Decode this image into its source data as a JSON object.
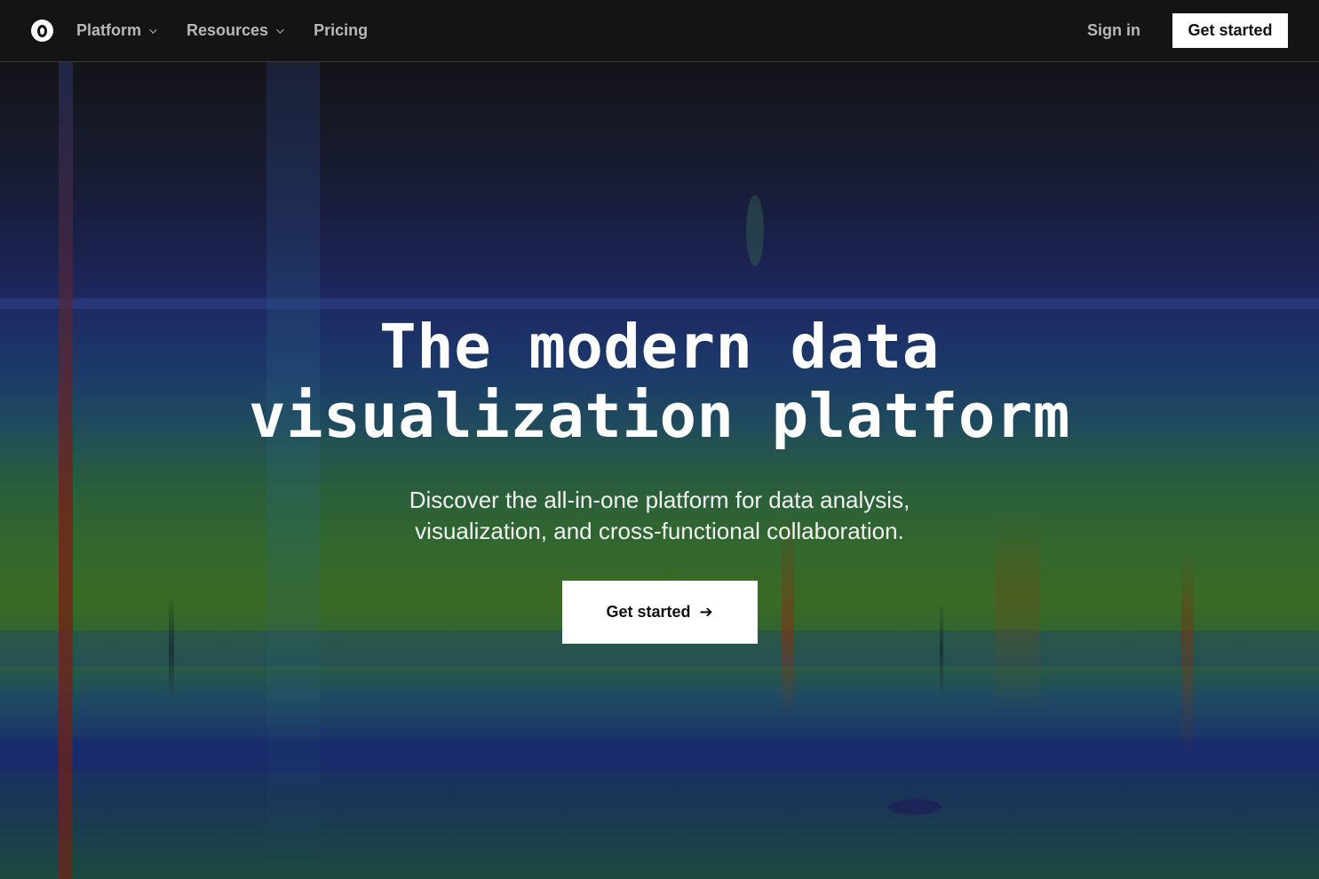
{
  "nav": {
    "items": [
      {
        "label": "Platform",
        "has_dropdown": true
      },
      {
        "label": "Resources",
        "has_dropdown": true
      },
      {
        "label": "Pricing",
        "has_dropdown": false
      }
    ],
    "signin_label": "Sign in",
    "cta_label": "Get started"
  },
  "hero": {
    "title_line1": "The modern data",
    "title_line2": "visualization platform",
    "subtitle_line1": "Discover the all-in-one platform for data analysis,",
    "subtitle_line2": "visualization, and cross-functional collaboration.",
    "cta_label": "Get started",
    "cta_icon": "arrow-right-icon"
  },
  "colors": {
    "nav_bg": "#141414",
    "nav_text": "#b8b8b8",
    "cta_bg": "#ffffff",
    "cta_text": "#111111"
  }
}
